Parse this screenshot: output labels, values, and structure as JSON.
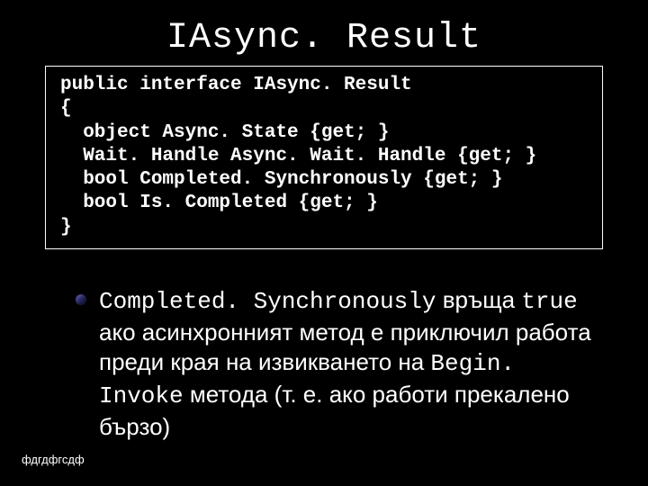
{
  "title": "IAsync. Result",
  "code": {
    "l1": "public interface IAsync. Result",
    "l2": "{",
    "l3": "  object Async. State {get; }",
    "l4": "  Wait. Handle Async. Wait. Handle {get; }",
    "l5": "  bool Completed. Synchronously {get; }",
    "l6": "  bool Is. Completed {get; }",
    "l7": "}"
  },
  "bullet": {
    "m1": "Completed. Synchronously",
    "t1": " връща ",
    "m2": "true",
    "t2": " ако асинхронният метод е приключил работа преди края на извикването на ",
    "m3": "Begin. Invoke",
    "t3": " метода (т. е. ако работи прекалено бързо)"
  },
  "footer": "фдгдфгсдф"
}
